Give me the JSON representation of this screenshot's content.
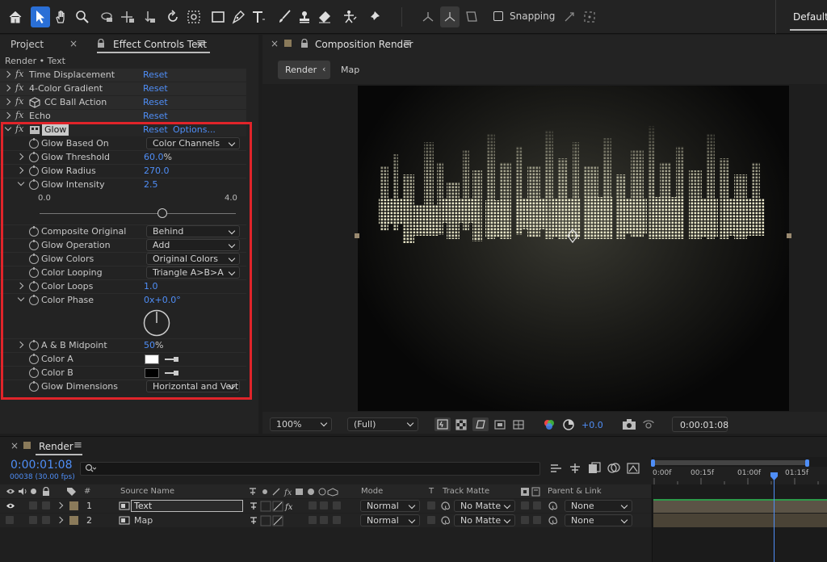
{
  "toolbar": {
    "snapping_label": "Snapping",
    "workspace_label": "Default",
    "icons": [
      "home-icon",
      "selection-tool-icon",
      "hand-tool-icon",
      "zoom-tool-icon",
      "orbit-camera-icon",
      "pan-camera-icon",
      "dolly-camera-icon",
      "rotate-tool-icon",
      "anchor-point-tool-icon",
      "rectangle-tool-icon",
      "pen-tool-icon",
      "type-tool-icon",
      "brush-tool-icon",
      "clone-stamp-icon",
      "eraser-icon",
      "puppet-tool-icon",
      "pin-icon"
    ]
  },
  "left_panel": {
    "tab_project": "Project",
    "tab_effect_controls": "Effect Controls Text",
    "breadcrumb": "Render • Text",
    "effects": [
      {
        "name": "Time Displacement",
        "reset": "Reset"
      },
      {
        "name": "4-Color Gradient",
        "reset": "Reset"
      },
      {
        "name": "CC Ball Action",
        "reset": "Reset"
      },
      {
        "name": "Echo",
        "reset": "Reset"
      }
    ],
    "glow": {
      "name": "Glow",
      "reset": "Reset",
      "options": "Options...",
      "glow_based_on": {
        "label": "Glow Based On",
        "value": "Color Channels"
      },
      "glow_threshold": {
        "label": "Glow Threshold",
        "value": "60.0",
        "unit": "%"
      },
      "glow_radius": {
        "label": "Glow Radius",
        "value": "270.0"
      },
      "glow_intensity": {
        "label": "Glow Intensity",
        "value": "2.5",
        "min": "0.0",
        "max": "4.0",
        "level": 0.625
      },
      "composite_original": {
        "label": "Composite Original",
        "value": "Behind"
      },
      "glow_operation": {
        "label": "Glow Operation",
        "value": "Add"
      },
      "glow_colors": {
        "label": "Glow Colors",
        "value": "Original Colors"
      },
      "color_looping": {
        "label": "Color Looping",
        "value": "Triangle A>B>A"
      },
      "color_loops": {
        "label": "Color Loops",
        "value": "1.0"
      },
      "color_phase": {
        "label": "Color Phase",
        "value_a": "0x",
        "value_b": "+0.0°"
      },
      "ab_midpoint": {
        "label": "A & B Midpoint",
        "value": "50",
        "unit": "%"
      },
      "color_a": {
        "label": "Color A",
        "swatch": "#ffffff"
      },
      "color_b": {
        "label": "Color B",
        "swatch": "#000000"
      },
      "glow_dimensions": {
        "label": "Glow Dimensions",
        "value": "Horizontal and Vertical"
      }
    },
    "highlight_color": "#e0242a"
  },
  "composition": {
    "title": "Composition Render",
    "breadcrumb_active": "Render",
    "breadcrumb_next": "Map",
    "footer": {
      "zoom": "100%",
      "resolution": "(Full)",
      "exposure": "+0.0",
      "timecode": "0:00:01:08"
    }
  },
  "timeline": {
    "tab_title": "Render",
    "timecode": "0:00:01:08",
    "frame_info": "00038 (30.00 fps)",
    "search_placeholder": "",
    "col_hash": "#",
    "col_source": "Source Name",
    "col_mode": "Mode",
    "col_t": "T",
    "col_trackmatte": "Track Matte",
    "col_parent": "Parent & Link",
    "ruler": [
      "0:00f",
      "00:15f",
      "01:00f",
      "01:15f"
    ],
    "layers": [
      {
        "num": "1",
        "name": "Text",
        "mode": "Normal",
        "matte": "No Matte",
        "parent": "None",
        "selected": true
      },
      {
        "num": "2",
        "name": "Map",
        "mode": "Normal",
        "matte": "No Matte",
        "parent": "None",
        "selected": false
      }
    ]
  }
}
